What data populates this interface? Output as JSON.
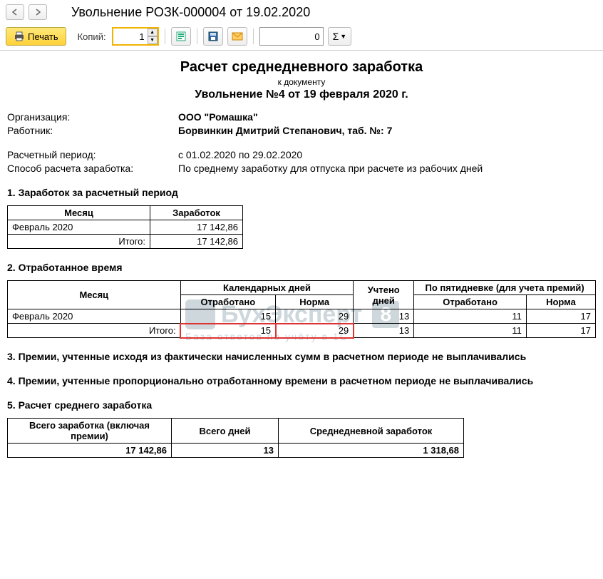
{
  "header": {
    "doc_title": "Увольнение РОЗК-000004 от 19.02.2020"
  },
  "toolbar": {
    "print_label": "Печать",
    "copies_label": "Копий:",
    "copies_value": "1",
    "big_value": "0",
    "sum_label": "Σ"
  },
  "report": {
    "title": "Расчет среднедневного заработка",
    "subtitle": "к документу",
    "doc_line": "Увольнение №4 от 19 февраля 2020 г.",
    "org_label": "Организация:",
    "org_value": "ООО \"Ромашка\"",
    "emp_label": "Работник:",
    "emp_value": "Борвинкин Дмитрий Степанович, таб. №: 7",
    "period_label": "Расчетный период:",
    "period_value": "с 01.02.2020 по 29.02.2020",
    "method_label": "Способ расчета заработка:",
    "method_value": "По среднему заработку для отпуска при расчете из рабочих дней"
  },
  "section1": {
    "heading": "1. Заработок за расчетный период",
    "col_month": "Месяц",
    "col_earn": "Заработок",
    "row_month": "Февраль 2020",
    "row_value": "17 142,86",
    "total_label": "Итого:",
    "total_value": "17 142,86"
  },
  "section2": {
    "heading": "2. Отработанное время",
    "col_month": "Месяц",
    "col_cal": "Календарных дней",
    "col_counted": "Учтено дней",
    "col_five": "По пятидневке (для учета премий)",
    "col_worked": "Отработано",
    "col_norm": "Норма",
    "row_month": "Февраль 2020",
    "r_worked": "15",
    "r_norm": "29",
    "r_counted": "13",
    "r_f_worked": "11",
    "r_f_norm": "17",
    "total_label": "Итого:",
    "t_worked": "15",
    "t_norm": "29",
    "t_counted": "13",
    "t_f_worked": "11",
    "t_f_norm": "17"
  },
  "section3": {
    "heading": "3. Премии, учтенные исходя из фактически начисленных сумм в расчетном периоде не выплачивались"
  },
  "section4": {
    "heading": "4. Премии, учтенные пропорционально отработанному времени в расчетном периоде не выплачивались"
  },
  "section5": {
    "heading": "5. Расчет среднего  заработка",
    "col_total_earn": "Всего заработка (включая премии)",
    "col_total_days": "Всего дней",
    "col_avg": "Среднедневной заработок",
    "v_total_earn": "17 142,86",
    "v_total_days": "13",
    "v_avg": "1 318,68"
  },
  "watermark": {
    "main": "БухЭксперт",
    "badge": "8",
    "sub": "База ответов по учёту в 1С"
  }
}
